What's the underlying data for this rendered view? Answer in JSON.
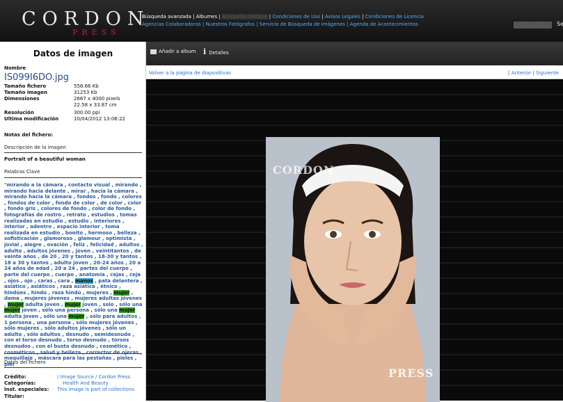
{
  "header": {
    "logo": "CORDON",
    "logo_sub": "PRESS",
    "nav1": [
      "Búsqueda avanzada",
      "Albumes",
      "Búsqueda múltiple",
      "Condiciones de Uso",
      "Avisos Legales",
      "Condiciones de Licencia"
    ],
    "nav2": [
      "Agencias Colaboradoras",
      "Nuestros Fotógrafos",
      "Servicio de Búsqueda de imágenes",
      "Agenda de Acontecimientos"
    ],
    "user_initial": "Se"
  },
  "sidebar": {
    "title": "Datos de imagen",
    "nombre_label": "Nombre",
    "filename": "IS099I6DO.jpg",
    "rows": [
      {
        "label": "Tamaño fichero",
        "value": "558.66 Kb"
      },
      {
        "label": "Tamaño imagen",
        "value": "31253 Kb"
      },
      {
        "label": "Dimensiones",
        "value": "2667 x 4000 pixels"
      },
      {
        "label": "",
        "value": "22.58 x 33.87 cm"
      },
      {
        "label": "Resolución",
        "value": "300.00 ppi"
      },
      {
        "label": "Ultima modificación",
        "value": "10/04/2012 13:06:22"
      }
    ],
    "notas_label": "Notas del fichero:",
    "desc_label": "Descripción de la imagen",
    "desc_value": "Portrait of a beautiful woman",
    "kw_label": "Palabras Clave",
    "datos_label": "Datos del fichero",
    "credit_rows": [
      {
        "label": "Crédito:",
        "value": "/ Image Source / Cordon Press"
      },
      {
        "label": "Categorías:",
        "value": "Health And Beauty"
      },
      {
        "label": "Inst. especiales:",
        "value": "This image is part of collections"
      },
      {
        "label": "Titular:",
        "value": ""
      }
    ]
  },
  "keywords": {
    "t1": "\"mirando a la cámara , contacto visual , mirando , mirando hacia delante , mirar , hacia la cámara , mirando hacia la cámara , fondos , fondo , colores , fondos de color , fondo de color , de color , color , fondo gris , colores de fondo , color de fondo , fotografías de rostro , retrato , estudios , tomas realizadas en estudio , estudio , interiores , interior , adentro , espacio interior , toma realizada en estudio , bonito , hermoso , belleza , sofisticación , glamoroso , glamour , optimista , jovial , alegre , ovación , feliz , felicidad , adultos , adulto , adultos jóvenes , joven , veintitantos , de veinte años , de 20 , 20 y tantos , 18-30 y tantos , 18 a 30 y tantos , adulto joven , 20-24 años , 20 a 24 años de edad , 20 a 24 , partes del cuerpo , parte del cuerpo , cuerpo , anatomía , cejas , ceja , ojos , ojo , caras , cara , ",
    "h1": "manos",
    "t2": " , pata delantera , asiático , asiáticos , raza asiática , étnico , hindúes , hindú , raza hindú , mujeres , ",
    "h2": "mujer",
    "t3": " , dama , mujeres jóvenes , mujeres adultas jóvenes , ",
    "h3": "mujer",
    "t4": " adulta joven , ",
    "h4": "mujer",
    "t5": " joven , solo , sólo una ",
    "h5": "mujer",
    "t6": " joven , sólo una persona , sólo una ",
    "h6": "mujer",
    "t7": " adulta joven , sólo una ",
    "h7": "mujer",
    "t8": " , sólo para adultos , 1 persona , una persona , sólo mujeres jóvenes , sólo mujeres , sólo adultos jóvenes , sólo un adulto , sólo adultos , desnudo , semidesnudo , con el torso desnudo , torso desnudo , torsos desnudos , con el busto desnudo , cosmético , cosméticos , salud y belleza , corrector de ojeras , maquillaje , máscara para las pestañas , pieles , piel"
  },
  "toolbar": {
    "add_album": "Añadir a album",
    "details_icon": "i",
    "details": "Detalles"
  },
  "navbar": {
    "back": "Volver a la página de diapositivas",
    "prev": "Anterior",
    "next": "Siguiente"
  },
  "photo": {
    "wm_top": "CORDON",
    "wm_bottom": "PRESS"
  },
  "colors": {
    "link": "#2a70c8",
    "highlight_green": "#3a9a2a",
    "highlight_blue": "#3aa0c8",
    "brand_red": "#c0202a"
  }
}
